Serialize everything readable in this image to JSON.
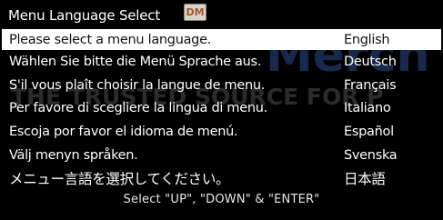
{
  "menu": {
    "title": "Menu Language Select",
    "logo_text": "DM",
    "selected_index": 0,
    "languages": [
      {
        "prompt": "Please select a menu language.",
        "name": "English"
      },
      {
        "prompt": "Wählen Sie bitte die Menü Sprache aus.",
        "name": "Deutsch"
      },
      {
        "prompt": "S'il vous plaît choisir la langue de menu.",
        "name": "Français"
      },
      {
        "prompt": "Per favore di scegliere la lingua di menu.",
        "name": "Italiano"
      },
      {
        "prompt": "Escoja por favor el idioma de menú.",
        "name": "Español"
      },
      {
        "prompt": "Välj menyn språken.",
        "name": "Svenska"
      },
      {
        "prompt": "メニュー言語を選択してください。",
        "name": "日本語"
      }
    ],
    "footer": "Select \"UP\", \"DOWN\" & \"ENTER\""
  },
  "watermark": {
    "line1": "Merch",
    "line2": "THE TRUSTED SOURCE FOR P"
  },
  "colors": {
    "background": "#000000",
    "text": "#ffffff",
    "selection": "#ffffff",
    "selection_text": "#111111",
    "watermark": "#2b4a8c"
  }
}
